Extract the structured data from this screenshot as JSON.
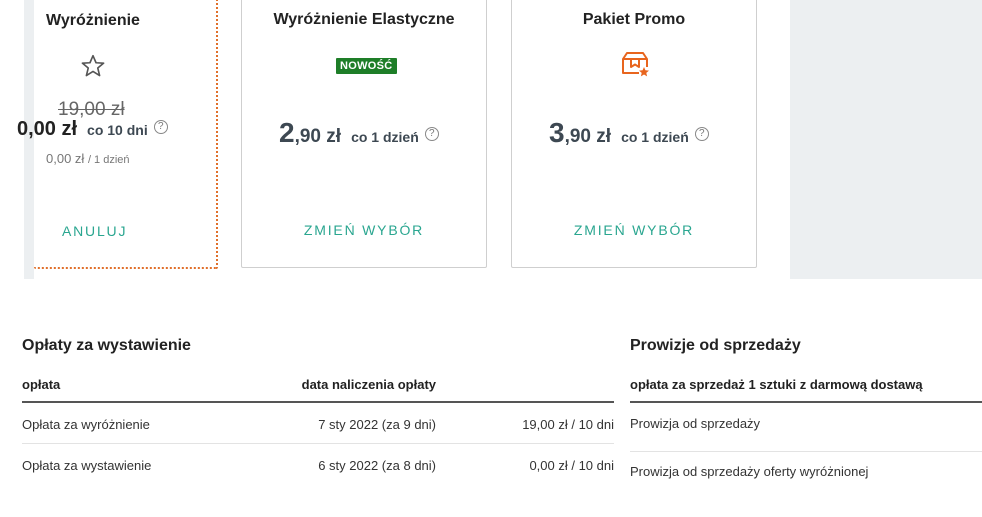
{
  "cards": [
    {
      "title": "Wyróżnienie",
      "icon": "star-outline-icon",
      "old_price": "19,00 zł",
      "price_int": "0",
      "price_frac": ",00 zł",
      "period": "co 10 dni",
      "sub_price": "0,00 zł",
      "sub_period": "/ 1 dzień",
      "action": "ANULUJ"
    },
    {
      "title": "Wyróżnienie Elastyczne",
      "badge": "NOWOŚĆ",
      "price_int": "2",
      "price_frac": ",90 zł",
      "period": "co 1 dzień",
      "action": "ZMIEŃ WYBÓR"
    },
    {
      "title": "Pakiet Promo",
      "icon": "package-star-icon",
      "price_int": "3",
      "price_frac": ",90 zł",
      "period": "co 1 dzień",
      "action": "ZMIEŃ WYBÓR"
    }
  ],
  "help_symbol": "?",
  "colors": {
    "accent": "#2aa690",
    "selected_border": "#e0702b",
    "badge": "#1e7e28",
    "icon_orange": "#e8651e"
  },
  "fees": {
    "title": "Opłaty za wystawienie",
    "headers": {
      "fee": "opłata",
      "date": "data naliczenia opłaty"
    },
    "rows": [
      {
        "name": "Opłata za wyróżnienie",
        "date": "7 sty 2022 (za 9 dni)",
        "amount": "19,00 zł / 10 dni"
      },
      {
        "name": "Opłata za wystawienie",
        "date": "6 sty 2022 (za 8 dni)",
        "amount": "0,00 zł / 10 dni"
      }
    ]
  },
  "commissions": {
    "title": "Prowizje od sprzedaży",
    "header": "opłata za sprzedaż 1 sztuki z darmową dostawą",
    "rows": [
      "Prowizja od sprzedaży",
      "Prowizja od sprzedaży oferty wyróżnionej"
    ]
  }
}
